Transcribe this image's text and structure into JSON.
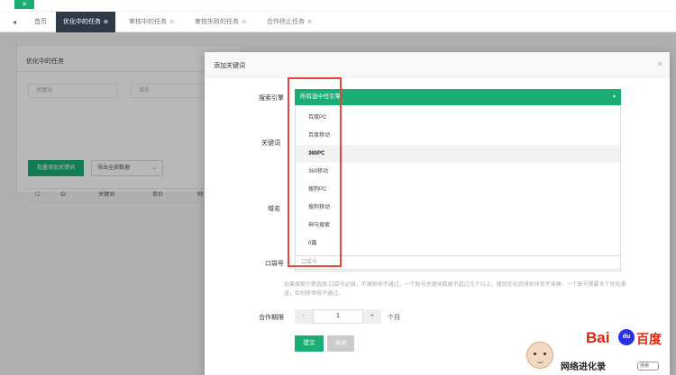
{
  "topbar": {
    "menu_icon": "≡"
  },
  "tabs": {
    "arrow": "◂",
    "items": [
      {
        "label": "首页"
      },
      {
        "label": "优化中的任务",
        "active": true
      },
      {
        "label": "审核中的任务"
      },
      {
        "label": "审核失败的任务"
      },
      {
        "label": "合作终止任务"
      }
    ]
  },
  "page": {
    "card_title": "优化中的任务",
    "keyword_placeholder": "关键词",
    "site_placeholder": "域名",
    "add_button": "批量添加关键词",
    "export_select": "导出全部数据",
    "table_headers": [
      "ID",
      "关键词",
      "单价",
      "网"
    ]
  },
  "modal": {
    "title": "添加关键词",
    "close": "×",
    "engine_label": "搜索引擎",
    "engine_selected": "所有选中任引擎",
    "engine_options": [
      "百度PC",
      "百度移动",
      "360PC",
      "360移动",
      "搜狗PC",
      "搜狗移动",
      "神马搜索",
      "0篇"
    ],
    "engine_highlight": "360PC",
    "keyword_label": "关键词",
    "domain_label": "域名",
    "qq_label": "口袋号",
    "qq_placeholder": "口袋号",
    "tip": "如果搜索引擎选择 口袋号必填，不满审核不通过，一个账号关键词数据不超过几个以上，搜到优化后排名排名不准确，一个账号需要多个优化渠道，否则将审核不通过。",
    "period_label": "合作期限",
    "minus": "-",
    "plus": "+",
    "period_value": "1",
    "period_unit": "个月",
    "submit": "提交",
    "cancel": "关闭"
  },
  "watermark": {
    "bai": "Bai",
    "du_paw": "du",
    "du_cn": "百度",
    "text": "网络进化录",
    "search": "搜索"
  },
  "colors": {
    "accent": "#1aad74",
    "dark_tab": "#2e3a46",
    "highlight_box": "#e8453c"
  }
}
